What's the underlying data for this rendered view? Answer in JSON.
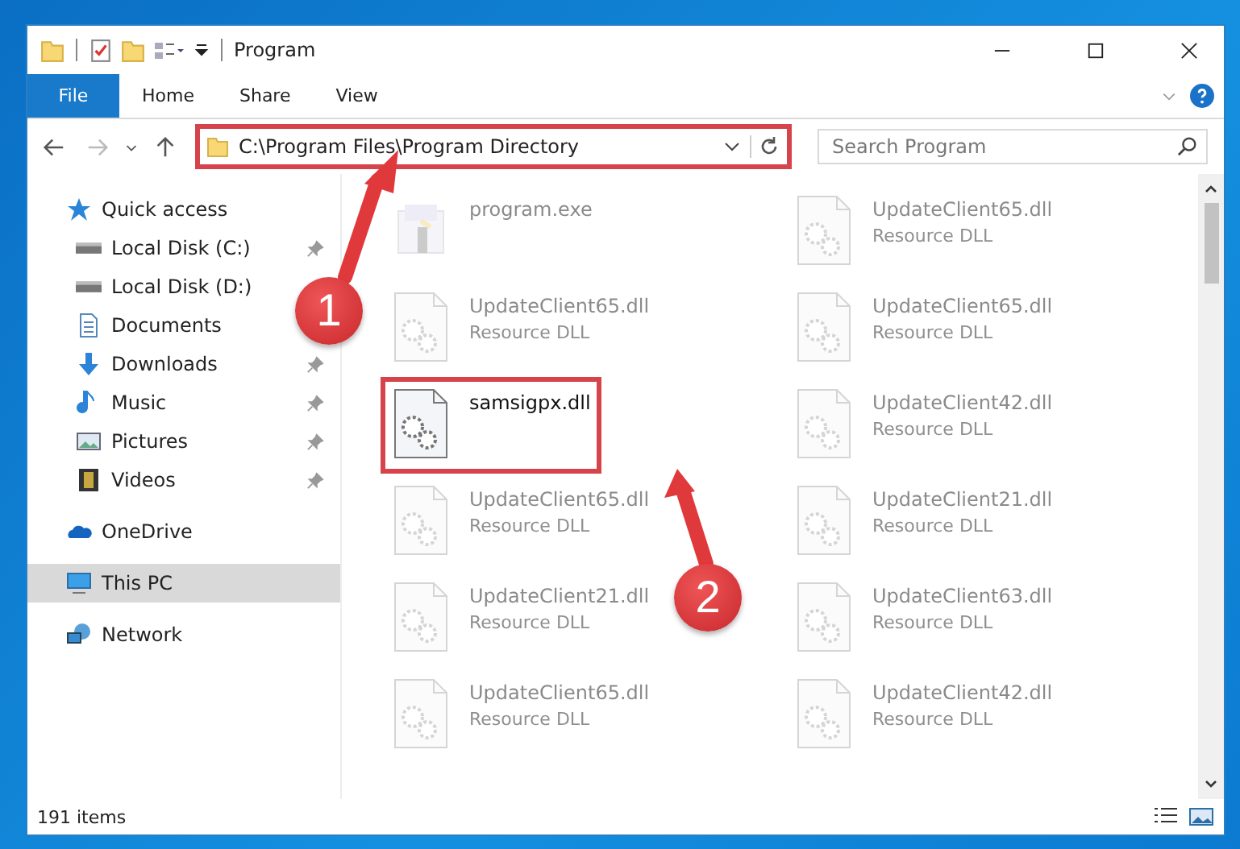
{
  "window": {
    "title": "Program"
  },
  "ribbon_tabs": [
    {
      "label": "File",
      "selected": true
    },
    {
      "label": "Home",
      "selected": false
    },
    {
      "label": "Share",
      "selected": false
    },
    {
      "label": "View",
      "selected": false
    }
  ],
  "address": {
    "path": "C:\\Program Files\\Program Directory",
    "highlighted": true
  },
  "search": {
    "placeholder": "Search Program"
  },
  "sidebar": {
    "items": [
      {
        "label": "Quick access",
        "kind": "star",
        "selected": false,
        "children": [
          {
            "label": "Local Disk (C:)",
            "kind": "drive",
            "pinned": true,
            "selected": false
          },
          {
            "label": "Local Disk (D:)",
            "kind": "drive",
            "pinned": false,
            "selected": false
          },
          {
            "label": "Documents",
            "kind": "document",
            "pinned": false,
            "selected": false
          },
          {
            "label": "Downloads",
            "kind": "download",
            "pinned": true,
            "selected": false
          },
          {
            "label": "Music",
            "kind": "music",
            "pinned": true,
            "selected": false
          },
          {
            "label": "Pictures",
            "kind": "pictures",
            "pinned": true,
            "selected": false
          },
          {
            "label": "Videos",
            "kind": "videos",
            "pinned": true,
            "selected": false
          }
        ]
      },
      {
        "label": "OneDrive",
        "kind": "cloud",
        "selected": false
      },
      {
        "label": "This PC",
        "kind": "computer",
        "selected": true
      },
      {
        "label": "Network",
        "kind": "network",
        "selected": false
      }
    ]
  },
  "files": [
    {
      "name": "program.exe",
      "kind": "application",
      "dimmed": true,
      "highlighted": false
    },
    {
      "name": "UpdateClient65.dll",
      "type": "Resource DLL",
      "kind": "library",
      "dimmed": true,
      "highlighted": false
    },
    {
      "name": "UpdateClient65.dll",
      "type": "Resource DLL",
      "kind": "library",
      "dimmed": true,
      "highlighted": false
    },
    {
      "name": "UpdateClient65.dll",
      "type": "Resource DLL",
      "kind": "library",
      "dimmed": true,
      "highlighted": false
    },
    {
      "name": "samsigpx.dll",
      "kind": "library",
      "dimmed": false,
      "highlighted": true
    },
    {
      "name": "UpdateClient42.dll",
      "type": "Resource DLL",
      "kind": "library",
      "dimmed": true,
      "highlighted": false
    },
    {
      "name": "UpdateClient65.dll",
      "type": "Resource DLL",
      "kind": "library",
      "dimmed": true,
      "highlighted": false
    },
    {
      "name": "UpdateClient21.dll",
      "type": "Resource DLL",
      "kind": "library",
      "dimmed": true,
      "highlighted": false
    },
    {
      "name": "UpdateClient21.dll",
      "type": "Resource DLL",
      "kind": "library",
      "dimmed": true,
      "highlighted": false
    },
    {
      "name": "UpdateClient63.dll",
      "type": "Resource DLL",
      "kind": "library",
      "dimmed": true,
      "highlighted": false
    },
    {
      "name": "UpdateClient65.dll",
      "type": "Resource DLL",
      "kind": "library",
      "dimmed": true,
      "highlighted": false
    },
    {
      "name": "UpdateClient42.dll",
      "type": "Resource DLL",
      "kind": "library",
      "dimmed": true,
      "highlighted": false
    }
  ],
  "status_bar": {
    "count": "191 items"
  },
  "annotations": [
    {
      "label": "1"
    },
    {
      "label": "2"
    }
  ]
}
